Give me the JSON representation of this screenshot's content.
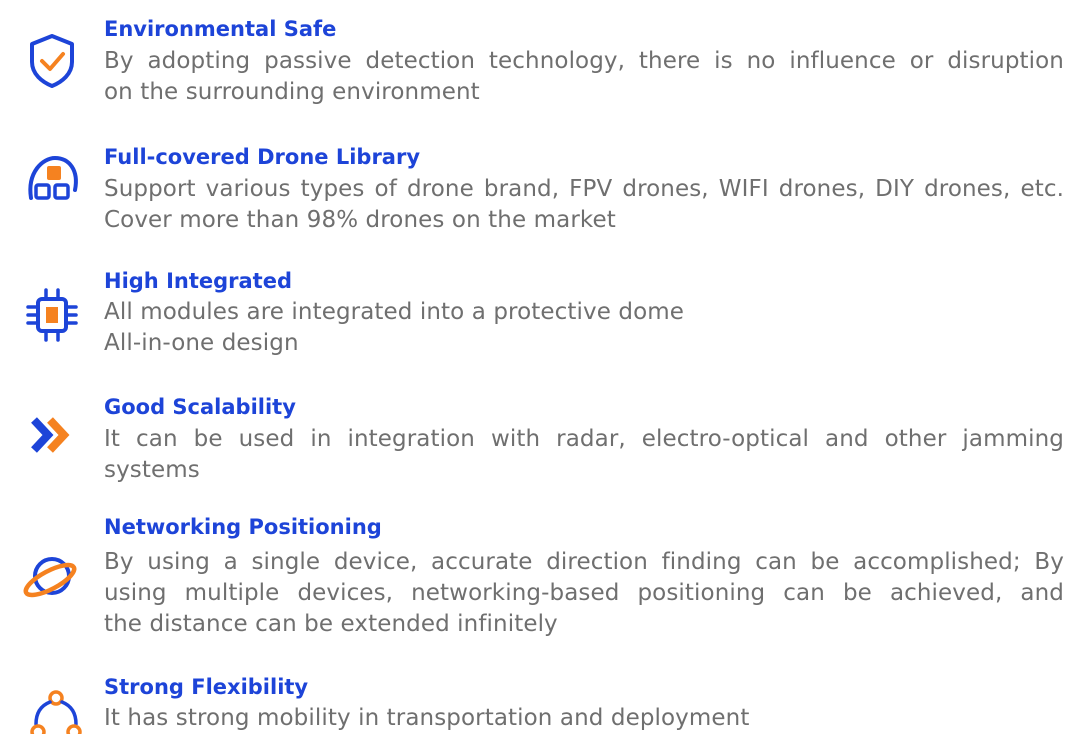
{
  "colors": {
    "title": "#1d44d8",
    "text": "#6f6f6f",
    "icon_blue": "#1d44d8",
    "icon_orange": "#f58220"
  },
  "features": [
    {
      "icon": "shield-check-icon",
      "title": "Environmental Safe",
      "lines": [
        "By adopting passive detection technology, there is no influence or disruption",
        "on the surrounding environment"
      ]
    },
    {
      "icon": "drone-library-icon",
      "title": "Full-covered Drone Library",
      "lines": [
        "Support various types of drone brand, FPV drones, WIFI drones, DIY drones, etc.",
        "Cover more than 98% drones on the market"
      ]
    },
    {
      "icon": "chip-icon",
      "title": "High Integrated",
      "lines": [
        "All modules are integrated into a protective dome",
        "All-in-one design"
      ]
    },
    {
      "icon": "double-chevron-icon",
      "title": "Good Scalability",
      "lines": [
        "It can be used in integration with radar, electro-optical and other jamming",
        "systems"
      ]
    },
    {
      "icon": "orbit-globe-icon",
      "title": "Networking Positioning",
      "lines": [
        "By using a single device, accurate direction finding can be accomplished; By",
        "using multiple devices, networking-based positioning can be achieved, and",
        "the distance can be extended infinitely"
      ]
    },
    {
      "icon": "network-nodes-icon",
      "title": "Strong Flexibility",
      "lines": [
        "It has strong mobility in transportation and deployment"
      ]
    }
  ]
}
